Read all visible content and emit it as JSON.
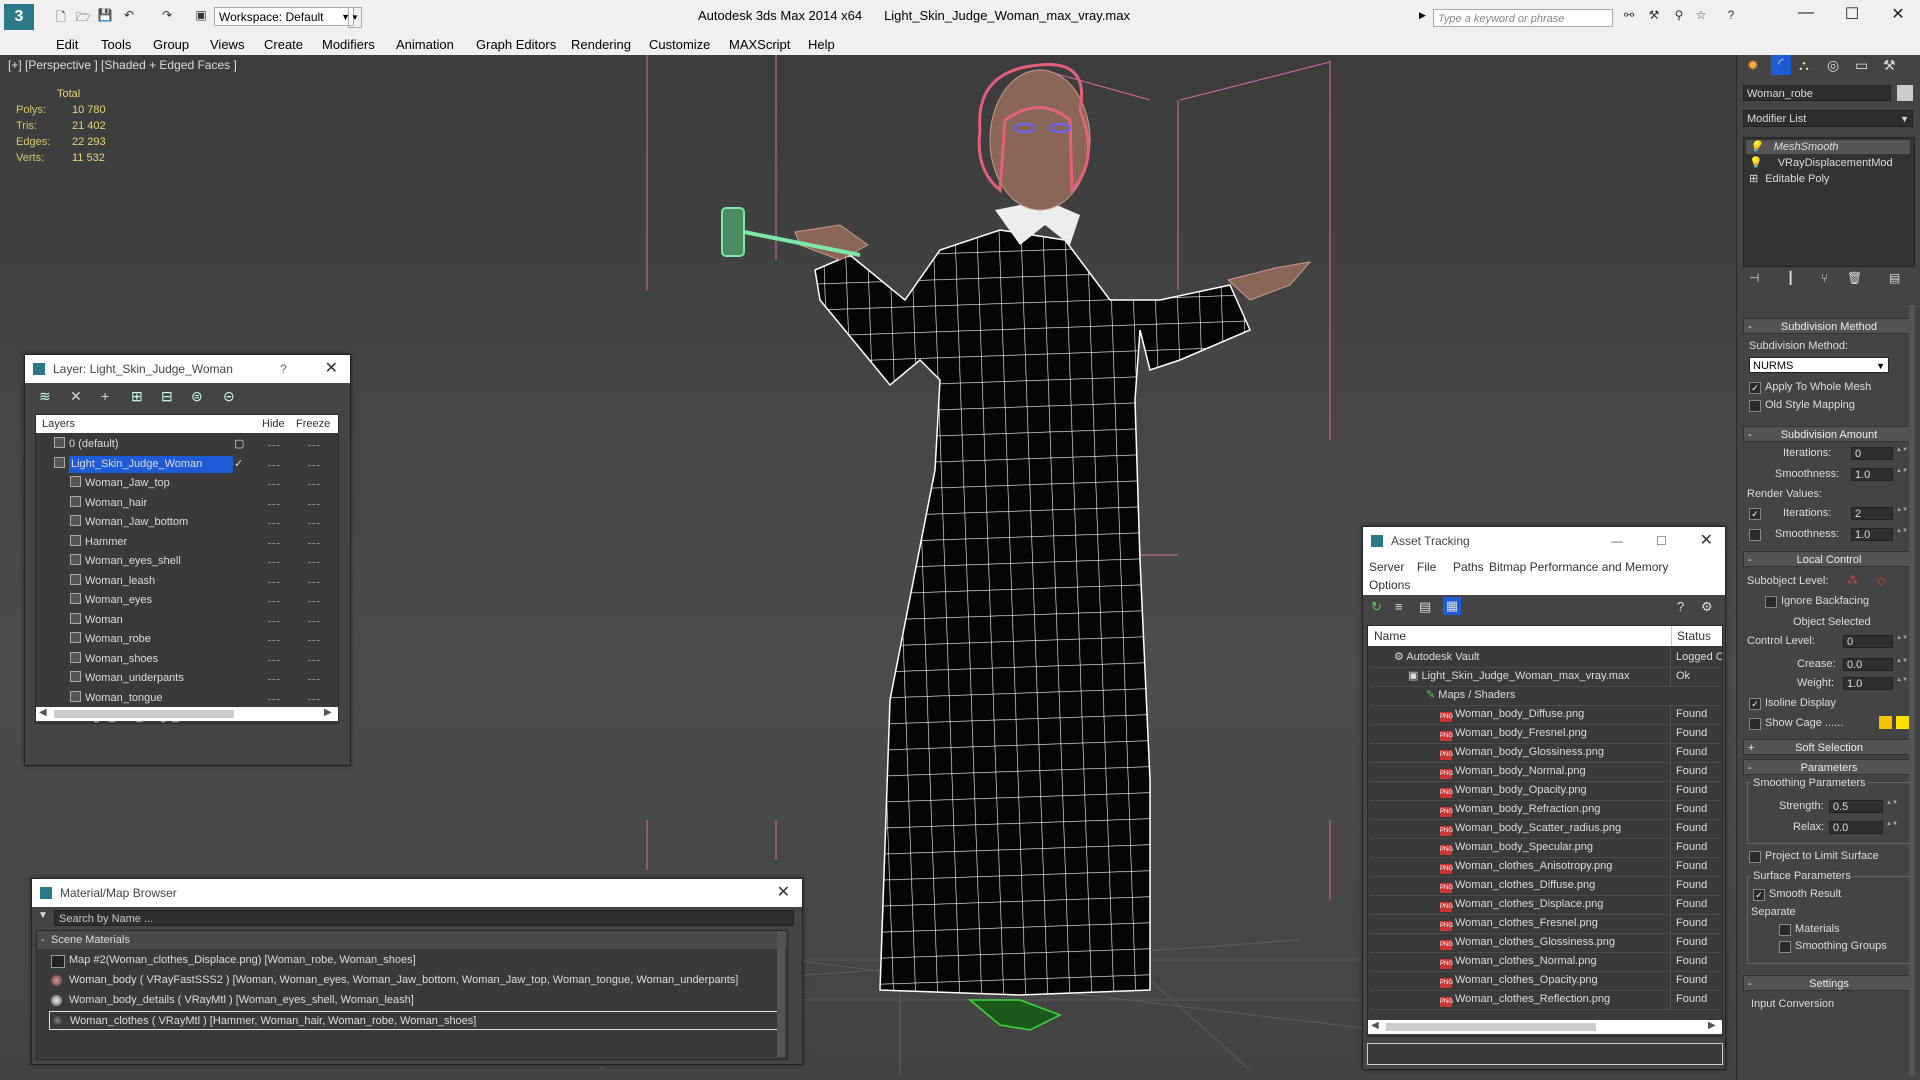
{
  "app": {
    "title": "Autodesk 3ds Max  2014 x64",
    "file": "Light_Skin_Judge_Woman_max_vray.max",
    "workspace": "Workspace: Default",
    "search_placeholder": "Type a keyword or phrase"
  },
  "menu": [
    "Edit",
    "Tools",
    "Group",
    "Views",
    "Create",
    "Modifiers",
    "Animation",
    "Graph Editors",
    "Rendering",
    "Customize",
    "MAXScript",
    "Help"
  ],
  "viewport": {
    "label": "[+] [Perspective ] [Shaded + Edged Faces ]",
    "stats": {
      "header": "Total",
      "rows": [
        {
          "label": "Polys:",
          "value": "10 780"
        },
        {
          "label": "Tris:",
          "value": "21 402"
        },
        {
          "label": "Edges:",
          "value": "22 293"
        },
        {
          "label": "Verts:",
          "value": "11 532"
        }
      ]
    }
  },
  "layer_window": {
    "title": "Layer: Light_Skin_Judge_Woman",
    "help": "?",
    "cols": {
      "layers": "Layers",
      "hide": "Hide",
      "freeze": "Freeze"
    },
    "rows": [
      {
        "name": "0 (default)",
        "indent": 1
      },
      {
        "name": "Light_Skin_Judge_Woman",
        "indent": 1,
        "selected": true
      },
      {
        "name": "Woman_Jaw_top",
        "indent": 2
      },
      {
        "name": "Woman_hair",
        "indent": 2
      },
      {
        "name": "Woman_Jaw_bottom",
        "indent": 2
      },
      {
        "name": "Hammer",
        "indent": 2
      },
      {
        "name": "Woman_eyes_shell",
        "indent": 2
      },
      {
        "name": "Woman_leash",
        "indent": 2
      },
      {
        "name": "Woman_eyes",
        "indent": 2
      },
      {
        "name": "Woman",
        "indent": 2
      },
      {
        "name": "Woman_robe",
        "indent": 2
      },
      {
        "name": "Woman_shoes",
        "indent": 2
      },
      {
        "name": "Woman_underpants",
        "indent": 2
      },
      {
        "name": "Woman_tongue",
        "indent": 2
      },
      {
        "name": "Light_Skin_Judge_Woman",
        "indent": 2
      }
    ]
  },
  "material_browser": {
    "title": "Material/Map Browser",
    "search_placeholder": "Search by Name ...",
    "group": "Scene Materials",
    "items": [
      "Map #2(Woman_clothes_Displace.png) [Woman_robe, Woman_shoes]",
      "Woman_body  ( VRayFastSSS2 )  [Woman, Woman_eyes, Woman_Jaw_bottom, Woman_Jaw_top, Woman_tongue, Woman_underpants]",
      "Woman_body_details  ( VRayMtl )  [Woman_eyes_shell, Woman_leash]",
      "Woman_clothes  ( VRayMtl )  [Hammer, Woman_hair, Woman_robe, Woman_shoes]"
    ]
  },
  "asset_tracking": {
    "title": "Asset Tracking",
    "menu": [
      "Server",
      "File",
      "Paths",
      "Bitmap Performance and Memory",
      "Options"
    ],
    "cols": {
      "name": "Name",
      "status": "Status"
    },
    "rows": [
      {
        "name": "Autodesk Vault",
        "status": "Logged C",
        "level": 1,
        "type": "vault"
      },
      {
        "name": "Light_Skin_Judge_Woman_max_vray.max",
        "status": "Ok",
        "level": 2,
        "type": "max"
      },
      {
        "name": "Maps / Shaders",
        "status": "",
        "level": 3,
        "type": "maps"
      },
      {
        "name": "Woman_body_Diffuse.png",
        "status": "Found",
        "level": 4,
        "type": "png"
      },
      {
        "name": "Woman_body_Fresnel.png",
        "status": "Found",
        "level": 4,
        "type": "png"
      },
      {
        "name": "Woman_body_Glossiness.png",
        "status": "Found",
        "level": 4,
        "type": "png"
      },
      {
        "name": "Woman_body_Normal.png",
        "status": "Found",
        "level": 4,
        "type": "png"
      },
      {
        "name": "Woman_body_Opacity.png",
        "status": "Found",
        "level": 4,
        "type": "png"
      },
      {
        "name": "Woman_body_Refraction.png",
        "status": "Found",
        "level": 4,
        "type": "png"
      },
      {
        "name": "Woman_body_Scatter_radius.png",
        "status": "Found",
        "level": 4,
        "type": "png"
      },
      {
        "name": "Woman_body_Specular.png",
        "status": "Found",
        "level": 4,
        "type": "png"
      },
      {
        "name": "Woman_clothes_Anisotropy.png",
        "status": "Found",
        "level": 4,
        "type": "png"
      },
      {
        "name": "Woman_clothes_Diffuse.png",
        "status": "Found",
        "level": 4,
        "type": "png"
      },
      {
        "name": "Woman_clothes_Displace.png",
        "status": "Found",
        "level": 4,
        "type": "png"
      },
      {
        "name": "Woman_clothes_Fresnel.png",
        "status": "Found",
        "level": 4,
        "type": "png"
      },
      {
        "name": "Woman_clothes_Glossiness.png",
        "status": "Found",
        "level": 4,
        "type": "png"
      },
      {
        "name": "Woman_clothes_Normal.png",
        "status": "Found",
        "level": 4,
        "type": "png"
      },
      {
        "name": "Woman_clothes_Opacity.png",
        "status": "Found",
        "level": 4,
        "type": "png"
      },
      {
        "name": "Woman_clothes_Reflection.png",
        "status": "Found",
        "level": 4,
        "type": "png"
      }
    ]
  },
  "command_panel": {
    "object_name": "Woman_robe",
    "modifier_list": "Modifier List",
    "stack": [
      "MeshSmooth",
      "VRayDisplacementMod",
      "Editable Poly"
    ],
    "subdivision_method": {
      "header": "Subdivision Method",
      "label": "Subdivision Method:",
      "value": "NURMS",
      "apply_whole_mesh": "Apply To Whole Mesh",
      "old_style": "Old Style Mapping"
    },
    "subdivision_amount": {
      "header": "Subdivision Amount",
      "iterations_label": "Iterations:",
      "iterations": "0",
      "smoothness_label": "Smoothness:",
      "smoothness": "1.0",
      "render_values": "Render Values:",
      "r_iterations": "2",
      "r_smoothness": "1.0"
    },
    "local_control": {
      "header": "Local Control",
      "subobject": "Subobject Level:",
      "ignore_backfacing": "Ignore Backfacing",
      "object_selected": "Object Selected",
      "control_level_label": "Control Level:",
      "control_level": "0",
      "crease_label": "Crease:",
      "crease": "0.0",
      "weight_label": "Weight:",
      "weight": "1.0",
      "isoline": "Isoline Display",
      "show_cage": "Show Cage ......"
    },
    "soft_selection": "Soft Selection",
    "parameters": {
      "header": "Parameters",
      "smoothing": "Smoothing Parameters",
      "strength_label": "Strength:",
      "strength": "0.5",
      "relax_label": "Relax:",
      "relax": "0.0",
      "project": "Project to Limit Surface",
      "surface": "Surface Parameters",
      "smooth_result": "Smooth Result",
      "separate": "Separate",
      "materials": "Materials",
      "smoothing_groups": "Smoothing Groups"
    },
    "settings": {
      "header": "Settings",
      "input_conversion": "Input Conversion"
    }
  },
  "colors": {
    "accent": "#2b7a8a",
    "selection": "#1e5bd6",
    "stats": "#e8d678",
    "cage1": "#f2c200",
    "cage2": "#ffe000",
    "wire": "#ffffff",
    "bbox": "#d86aa0"
  }
}
